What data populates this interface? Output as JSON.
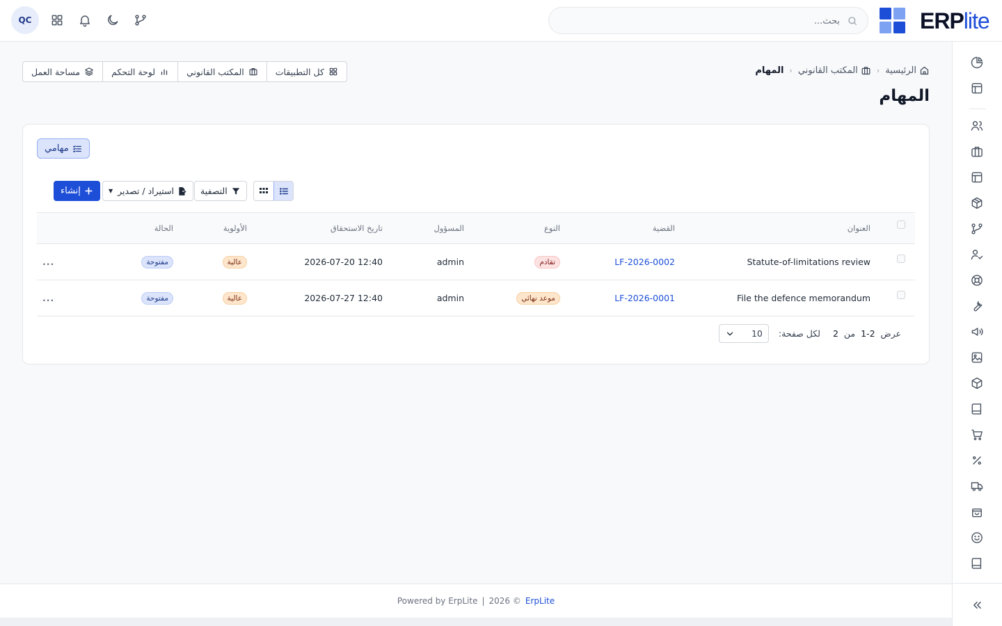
{
  "header": {
    "avatar_initials": "QC",
    "search_placeholder": "بحث...",
    "logo_erp": "ERP",
    "logo_lite": "lite",
    "icons": [
      "apps-grid-icon",
      "bell-icon",
      "moon-icon",
      "git-branch-icon",
      "search-icon"
    ]
  },
  "breadcrumb": {
    "home": "الرئيسية",
    "module": "المكتب القانوني",
    "current": "المهام"
  },
  "page_title": "المهام",
  "top_buttons": {
    "all_apps": "كل التطبيقات",
    "legal_office": "المكتب القانوني",
    "dashboard": "لوحة التحكم",
    "workspace": "مساحة العمل"
  },
  "tabs": {
    "my_tasks": "مهامي"
  },
  "toolbar": {
    "create": "إنشاء",
    "import_export": "استيراد / تصدير",
    "filter": "التصفية"
  },
  "table": {
    "columns": {
      "title": "العنوان",
      "case": "القضية",
      "type": "النوع",
      "assignee": "المسؤول",
      "due_date": "تاريخ الاستحقاق",
      "priority": "الأولوية",
      "status": "الحالة"
    },
    "rows": [
      {
        "title": "Statute-of-limitations review",
        "case": "LF-2026-0002",
        "type": "تقادم",
        "assignee": "admin",
        "due_date": "2026-07-20 12:40",
        "priority": "عالية",
        "status": "مفتوحة",
        "more": "..."
      },
      {
        "title": "File the defence memorandum",
        "case": "LF-2026-0001",
        "type": "موعد نهائي",
        "assignee": "admin",
        "due_date": "2026-07-27 12:40",
        "priority": "عالية",
        "status": "مفتوحة",
        "more": "..."
      }
    ]
  },
  "pagination": {
    "showing": "عرض",
    "range": "1-2",
    "of": "من",
    "total": "2",
    "per_page_label": "لكل صفحة:",
    "per_page_value": "10"
  },
  "footer": {
    "powered": "Powered by ErpLite",
    "separator": "|",
    "year": "2026 ©",
    "brand": "ErpLite"
  },
  "colors": {
    "primary": "#1d4ed8",
    "logo_dark": "#1e3a8a",
    "logo_light": "#7da2f2"
  }
}
